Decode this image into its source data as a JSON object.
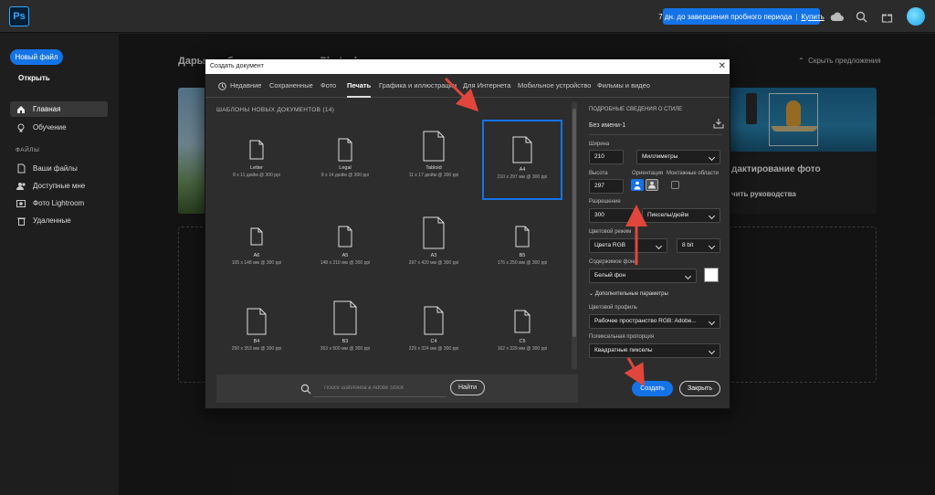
{
  "app": {
    "logo": "Ps"
  },
  "topbar": {
    "trial_text": "7 дн. до завершения пробного периода",
    "trial_sep": "|",
    "buy_label": "Купить",
    "icons": [
      "cloud-icon",
      "search-icon",
      "gift-icon",
      "avatar"
    ]
  },
  "sidebar": {
    "new_file": "Новый файл",
    "open": "Открыть",
    "items": [
      {
        "label": "Главная",
        "icon": "home-icon"
      },
      {
        "label": "Обучение",
        "icon": "lightbulb-icon"
      }
    ],
    "files_header": "ФАЙЛЫ",
    "files": [
      {
        "label": "Ваши файлы",
        "icon": "file-icon"
      },
      {
        "label": "Доступные мне",
        "icon": "people-icon"
      },
      {
        "label": "Фото Lightroom",
        "icon": "photo-icon"
      },
      {
        "label": "Удаленные",
        "icon": "trash-icon"
      }
    ]
  },
  "main": {
    "greeting": "Дарья, добро пожаловать в Photoshop",
    "hide_suggestions": "Скрыть предложения",
    "card_title": "дактирование фото",
    "card_link": "чить руководства"
  },
  "dialog": {
    "title": "Создать документ",
    "tabs": [
      "Недавние",
      "Сохраненные",
      "Фото",
      "Печать",
      "Графика и иллюстрации",
      "Для Интернета",
      "Мобильное устройство",
      "Фильмы и видео"
    ],
    "active_tab": "Печать",
    "templates_header": "ШАБЛОНЫ НОВЫХ ДОКУМЕНТОВ (14)",
    "templates": [
      {
        "name": "Letter",
        "size": "8 x 11 дюйм @ 300 ppi"
      },
      {
        "name": "Legal",
        "size": "8 x 14 дюйм @ 300 ppi"
      },
      {
        "name": "Tabloid",
        "size": "11 x 17 дюйм @ 300 ppi"
      },
      {
        "name": "A4",
        "size": "210 x 297 мм @ 300 ppi"
      },
      {
        "name": "A6",
        "size": "105 x 148 мм @ 300 ppi"
      },
      {
        "name": "A5",
        "size": "148 x 210 мм @ 300 ppi"
      },
      {
        "name": "A3",
        "size": "297 x 420 мм @ 300 ppi"
      },
      {
        "name": "B5",
        "size": "176 x 250 мм @ 300 ppi"
      },
      {
        "name": "B4",
        "size": "250 x 353 мм @ 300 ppi"
      },
      {
        "name": "B3",
        "size": "353 x 500 мм @ 300 ppi"
      },
      {
        "name": "C4",
        "size": "229 x 324 мм @ 300 ppi"
      },
      {
        "name": "C5",
        "size": "162 x 229 мм @ 300 ppi"
      }
    ],
    "selected_template": "A4",
    "search_placeholder": "Поиск шаблонов в Adobe Stock",
    "find_label": "Найти",
    "details": {
      "header": "ПОДРОБНЫЕ СВЕДЕНИЯ О СТИЛЕ",
      "name_value": "Без имени-1",
      "width_label": "Ширина",
      "width_value": "210",
      "unit_value": "Миллиметры",
      "height_label": "Высота",
      "height_value": "297",
      "orientation_label": "Ориентация",
      "artboards_label": "Монтажные области",
      "resolution_label": "Разрешение",
      "resolution_value": "300",
      "resolution_unit": "Пикселы/дюйм",
      "color_mode_label": "Цветовой режим",
      "color_mode_value": "Цвета RGB",
      "bit_value": "8 bit",
      "bg_label": "Содержимое фона",
      "bg_value": "Белый фон",
      "bg_color": "#ffffff",
      "advanced": "Дополнительные параметры",
      "profile_label": "Цветовой профиль",
      "profile_value": "Рабочее пространство RGB: Adobe...",
      "aspect_label": "Попиксельная пропорция",
      "aspect_value": "Квадратные пикселы"
    },
    "create_label": "Создать",
    "close_label": "Закрыть"
  },
  "colors": {
    "accent": "#1473e6",
    "annotation_arrow": "#e0463c"
  }
}
